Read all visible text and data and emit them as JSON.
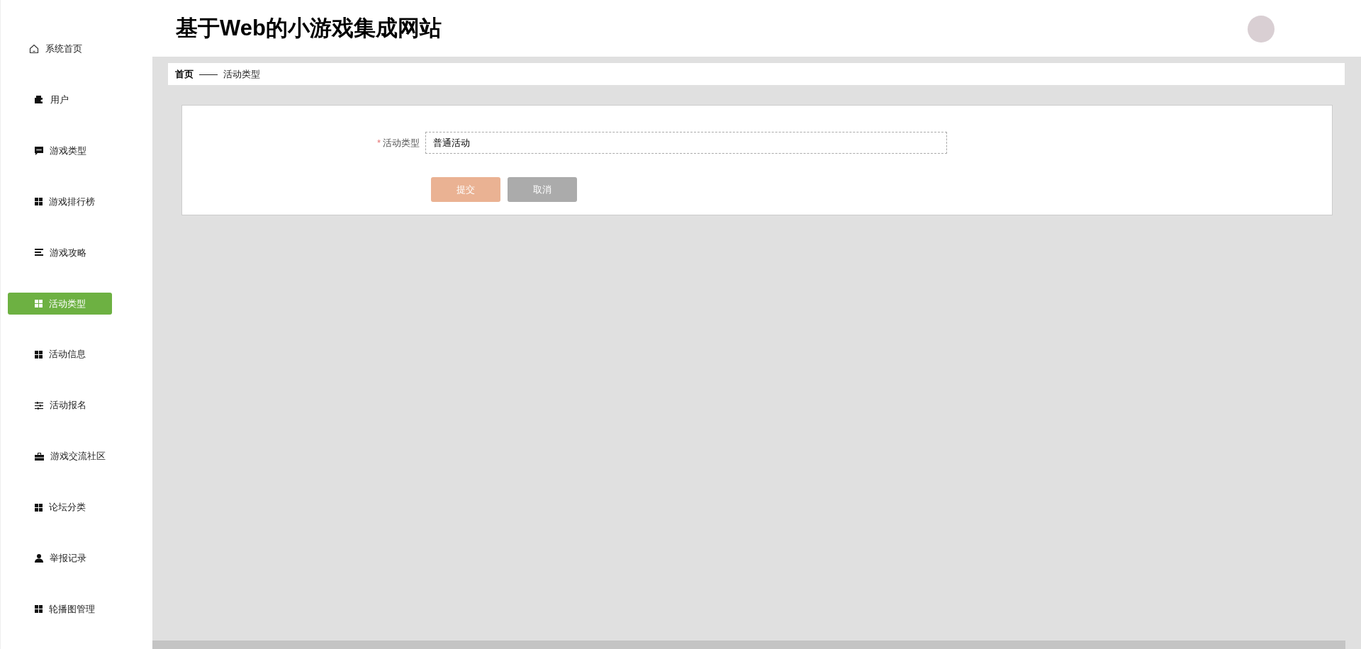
{
  "header": {
    "title": "基于Web的小游戏集成网站"
  },
  "sidebar": {
    "items": [
      {
        "label": "系统首页",
        "selected": false
      },
      {
        "label": "用户",
        "selected": false
      },
      {
        "label": "游戏类型",
        "selected": false
      },
      {
        "label": "游戏排行榜",
        "selected": false
      },
      {
        "label": "游戏攻略",
        "selected": false
      },
      {
        "label": "活动类型",
        "selected": true
      },
      {
        "label": "活动信息",
        "selected": false
      },
      {
        "label": "活动报名",
        "selected": false
      },
      {
        "label": "游戏交流社区",
        "selected": false
      },
      {
        "label": "论坛分类",
        "selected": false
      },
      {
        "label": "举报记录",
        "selected": false
      },
      {
        "label": "轮播图管理",
        "selected": false
      }
    ]
  },
  "breadcrumb": {
    "home": "首页",
    "separator": "——",
    "current": "活动类型"
  },
  "form": {
    "fields": [
      {
        "label": "活动类型",
        "required_mark": "*",
        "value": "普通活动"
      }
    ],
    "buttons": [
      {
        "kind": "submit",
        "label": "提交"
      },
      {
        "kind": "cancel",
        "label": "取消"
      }
    ]
  }
}
